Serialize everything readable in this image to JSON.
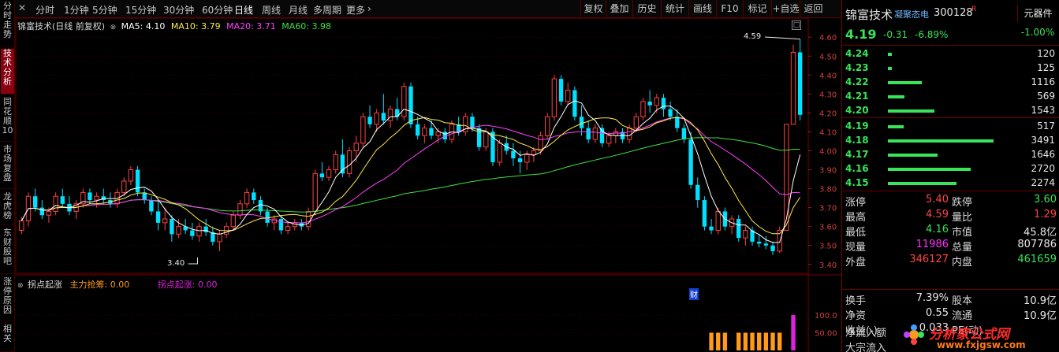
{
  "colors": {
    "up": "#ff4040",
    "down": "#00e0ff",
    "ma5": "#ffffff",
    "ma10": "#ffe84a",
    "ma20": "#ff40ff",
    "ma60": "#40e040",
    "indicator_orange": "#ff9a1a",
    "indicator_magenta": "#e020e0"
  },
  "left_tabs": [
    "分时走势",
    "技术分析",
    "同花顺10",
    "市场复盘",
    "龙虎榜",
    "东财股吧",
    "涨停原因",
    "相关"
  ],
  "toolbar": {
    "periods": [
      "分时",
      "1分钟",
      "5分钟",
      "15分钟",
      "30分钟",
      "60分钟",
      "日线",
      "周线",
      "月线",
      "多周期",
      "更多"
    ],
    "right_buttons": [
      "复权",
      "叠加",
      "历史",
      "统计",
      "画线",
      "F10",
      "标记",
      "+自选",
      "返回"
    ]
  },
  "chart_header": {
    "name": "锦富技术(日线 前复权)",
    "ma5": "MA5: 4.10",
    "ma10": "MA10: 3.79",
    "ma20": "MA20: 3.71",
    "ma60": "MA60: 3.98"
  },
  "chart_annotations": {
    "high_label": "4.59",
    "low_label": "3.40",
    "cai_mark": "财"
  },
  "indicator_header": {
    "name": "拐点起涨",
    "line1": "主力抢筹: 0.00",
    "line2": "拐点起涨: 0.00"
  },
  "chart_data": {
    "type": "candlestick",
    "y_axis_ticks": [
      "4.60",
      "4.50",
      "4.40",
      "4.30",
      "4.20",
      "4.10",
      "4.00",
      "3.90",
      "3.80",
      "3.70",
      "3.60",
      "3.50",
      "3.40"
    ],
    "indicator_ticks": [
      "100.0",
      "50.00"
    ],
    "ylim": [
      3.37,
      4.63
    ],
    "ohlc": [
      [
        3.58,
        3.65,
        3.56,
        3.63
      ],
      [
        3.63,
        3.78,
        3.6,
        3.76
      ],
      [
        3.76,
        3.8,
        3.68,
        3.7
      ],
      [
        3.7,
        3.74,
        3.64,
        3.66
      ],
      [
        3.66,
        3.7,
        3.62,
        3.68
      ],
      [
        3.68,
        3.78,
        3.66,
        3.76
      ],
      [
        3.76,
        3.8,
        3.7,
        3.72
      ],
      [
        3.72,
        3.76,
        3.66,
        3.68
      ],
      [
        3.68,
        3.74,
        3.64,
        3.72
      ],
      [
        3.72,
        3.8,
        3.7,
        3.78
      ],
      [
        3.78,
        3.8,
        3.72,
        3.74
      ],
      [
        3.74,
        3.78,
        3.7,
        3.76
      ],
      [
        3.76,
        3.8,
        3.72,
        3.74
      ],
      [
        3.74,
        3.78,
        3.7,
        3.72
      ],
      [
        3.72,
        3.8,
        3.7,
        3.78
      ],
      [
        3.78,
        3.86,
        3.76,
        3.84
      ],
      [
        3.84,
        3.92,
        3.82,
        3.9
      ],
      [
        3.9,
        3.92,
        3.76,
        3.78
      ],
      [
        3.78,
        3.8,
        3.72,
        3.74
      ],
      [
        3.74,
        3.76,
        3.66,
        3.68
      ],
      [
        3.68,
        3.74,
        3.58,
        3.62
      ],
      [
        3.62,
        3.7,
        3.58,
        3.64
      ],
      [
        3.64,
        3.66,
        3.52,
        3.56
      ],
      [
        3.56,
        3.64,
        3.54,
        3.6
      ],
      [
        3.6,
        3.64,
        3.56,
        3.58
      ],
      [
        3.58,
        3.62,
        3.53,
        3.55
      ],
      [
        3.55,
        3.62,
        3.52,
        3.6
      ],
      [
        3.6,
        3.64,
        3.55,
        3.57
      ],
      [
        3.57,
        3.6,
        3.5,
        3.52
      ],
      [
        3.52,
        3.58,
        3.47,
        3.56
      ],
      [
        3.56,
        3.62,
        3.54,
        3.6
      ],
      [
        3.6,
        3.68,
        3.58,
        3.66
      ],
      [
        3.66,
        3.74,
        3.64,
        3.72
      ],
      [
        3.72,
        3.8,
        3.7,
        3.78
      ],
      [
        3.78,
        3.8,
        3.72,
        3.74
      ],
      [
        3.74,
        3.76,
        3.66,
        3.68
      ],
      [
        3.68,
        3.7,
        3.6,
        3.62
      ],
      [
        3.62,
        3.66,
        3.58,
        3.64
      ],
      [
        3.64,
        3.66,
        3.56,
        3.58
      ],
      [
        3.58,
        3.62,
        3.56,
        3.6
      ],
      [
        3.6,
        3.64,
        3.58,
        3.62
      ],
      [
        3.62,
        3.64,
        3.58,
        3.6
      ],
      [
        3.6,
        3.7,
        3.58,
        3.68
      ],
      [
        3.68,
        3.9,
        3.66,
        3.88
      ],
      [
        3.88,
        3.94,
        3.84,
        3.86
      ],
      [
        3.86,
        3.92,
        3.84,
        3.9
      ],
      [
        3.9,
        4.0,
        3.88,
        3.98
      ],
      [
        3.98,
        4.06,
        3.86,
        3.88
      ],
      [
        3.88,
        4.02,
        3.86,
        4.0
      ],
      [
        4.0,
        4.08,
        3.94,
        4.04
      ],
      [
        4.04,
        4.2,
        4.02,
        4.18
      ],
      [
        4.18,
        4.24,
        4.12,
        4.14
      ],
      [
        4.14,
        4.22,
        4.1,
        4.2
      ],
      [
        4.2,
        4.3,
        4.14,
        4.16
      ],
      [
        4.16,
        4.24,
        4.12,
        4.22
      ],
      [
        4.22,
        4.28,
        4.16,
        4.18
      ],
      [
        4.18,
        4.36,
        4.16,
        4.34
      ],
      [
        4.34,
        4.36,
        4.12,
        4.14
      ],
      [
        4.14,
        4.18,
        4.06,
        4.08
      ],
      [
        4.08,
        4.14,
        4.04,
        4.12
      ],
      [
        4.12,
        4.16,
        4.06,
        4.08
      ],
      [
        4.08,
        4.12,
        4.04,
        4.1
      ],
      [
        4.1,
        4.12,
        4.04,
        4.06
      ],
      [
        4.06,
        4.16,
        4.04,
        4.14
      ],
      [
        4.14,
        4.18,
        4.08,
        4.1
      ],
      [
        4.1,
        4.2,
        4.08,
        4.18
      ],
      [
        4.18,
        4.2,
        4.1,
        4.12
      ],
      [
        4.12,
        4.14,
        4.0,
        4.02
      ],
      [
        4.02,
        4.12,
        4.0,
        4.1
      ],
      [
        4.1,
        4.12,
        3.92,
        3.94
      ],
      [
        3.94,
        4.06,
        3.92,
        4.04
      ],
      [
        4.04,
        4.08,
        3.98,
        4.0
      ],
      [
        4.0,
        4.04,
        3.92,
        3.96
      ],
      [
        3.96,
        4.0,
        3.88,
        3.94
      ],
      [
        3.94,
        4.0,
        3.9,
        3.98
      ],
      [
        3.98,
        4.02,
        3.94,
        4.0
      ],
      [
        4.0,
        4.1,
        3.98,
        4.08
      ],
      [
        4.08,
        4.2,
        4.06,
        4.18
      ],
      [
        4.18,
        4.4,
        4.16,
        4.38
      ],
      [
        4.38,
        4.4,
        4.24,
        4.26
      ],
      [
        4.26,
        4.36,
        4.24,
        4.32
      ],
      [
        4.32,
        4.34,
        4.16,
        4.18
      ],
      [
        4.18,
        4.24,
        4.08,
        4.12
      ],
      [
        4.12,
        4.16,
        4.04,
        4.06
      ],
      [
        4.06,
        4.14,
        4.04,
        4.12
      ],
      [
        4.12,
        4.14,
        4.02,
        4.04
      ],
      [
        4.04,
        4.1,
        4.02,
        4.08
      ],
      [
        4.08,
        4.12,
        4.04,
        4.1
      ],
      [
        4.1,
        4.12,
        4.04,
        4.06
      ],
      [
        4.06,
        4.14,
        4.04,
        4.12
      ],
      [
        4.12,
        4.2,
        4.1,
        4.18
      ],
      [
        4.18,
        4.28,
        4.16,
        4.26
      ],
      [
        4.26,
        4.32,
        4.2,
        4.24
      ],
      [
        4.24,
        4.3,
        4.2,
        4.28
      ],
      [
        4.28,
        4.3,
        4.18,
        4.22
      ],
      [
        4.22,
        4.26,
        4.16,
        4.18
      ],
      [
        4.18,
        4.22,
        4.1,
        4.12
      ],
      [
        4.12,
        4.14,
        4.04,
        4.06
      ],
      [
        4.06,
        4.1,
        3.8,
        3.82
      ],
      [
        3.82,
        3.86,
        3.7,
        3.74
      ],
      [
        3.74,
        3.76,
        3.58,
        3.6
      ],
      [
        3.6,
        3.64,
        3.56,
        3.58
      ],
      [
        3.58,
        3.7,
        3.56,
        3.68
      ],
      [
        3.68,
        3.7,
        3.58,
        3.6
      ],
      [
        3.6,
        3.66,
        3.56,
        3.64
      ],
      [
        3.64,
        3.66,
        3.52,
        3.54
      ],
      [
        3.54,
        3.6,
        3.5,
        3.58
      ],
      [
        3.58,
        3.6,
        3.5,
        3.52
      ],
      [
        3.52,
        3.56,
        3.49,
        3.51
      ],
      [
        3.51,
        3.55,
        3.48,
        3.5
      ],
      [
        3.5,
        3.52,
        3.45,
        3.47
      ],
      [
        3.47,
        3.6,
        3.46,
        3.58
      ],
      [
        3.58,
        4.14,
        3.58,
        4.14
      ],
      [
        4.14,
        4.56,
        4.14,
        4.52
      ],
      [
        4.52,
        4.59,
        4.16,
        4.19
      ]
    ],
    "indicator_bars": [
      0,
      0,
      0,
      0,
      0,
      0,
      0,
      0,
      0,
      0,
      0,
      0,
      0,
      0,
      0,
      0,
      0,
      0,
      0,
      0,
      0,
      0,
      0,
      0,
      0,
      0,
      0,
      0,
      0,
      0,
      0,
      0,
      0,
      0,
      0,
      0,
      0,
      0,
      0,
      0,
      0,
      0,
      0,
      0,
      0,
      0,
      0,
      0,
      0,
      0,
      0,
      0,
      0,
      0,
      0,
      0,
      0,
      0,
      0,
      0,
      0,
      0,
      0,
      0,
      0,
      0,
      0,
      0,
      0,
      0,
      0,
      0,
      0,
      0,
      0,
      0,
      0,
      0,
      0,
      0,
      0,
      0,
      0,
      0,
      0,
      0,
      0,
      0,
      0,
      0,
      0,
      0,
      0,
      0,
      0,
      0,
      0,
      0,
      0,
      0,
      0,
      0,
      50,
      50,
      50,
      0,
      50,
      50,
      50,
      50,
      50,
      50,
      50,
      0,
      100,
      0
    ],
    "indicator_bar_types": [
      "orange",
      "orange",
      "orange",
      "none",
      "orange",
      "orange",
      "orange",
      "orange",
      "orange",
      "orange",
      "orange",
      "none",
      "magenta",
      "none"
    ]
  },
  "quote": {
    "name": "锦富技术",
    "concept": "凝聚态电",
    "code": "300128",
    "code_mark": "R",
    "sector": "元器件",
    "price": "4.19",
    "change": "-0.31",
    "change_pct": "-6.89%",
    "sector_pct": "-1.00%"
  },
  "order_book": {
    "asks": [
      {
        "price": "4.24",
        "vol": "120",
        "bar": 0.035
      },
      {
        "price": "4.23",
        "vol": "125",
        "bar": 0.036
      },
      {
        "price": "4.22",
        "vol": "1116",
        "bar": 0.32
      },
      {
        "price": "4.21",
        "vol": "569",
        "bar": 0.16
      },
      {
        "price": "4.20",
        "vol": "1543",
        "bar": 0.44
      }
    ],
    "bids": [
      {
        "price": "4.19",
        "vol": "517",
        "bar": 0.15
      },
      {
        "price": "4.18",
        "vol": "3491",
        "bar": 1.0
      },
      {
        "price": "4.17",
        "vol": "1646",
        "bar": 0.47
      },
      {
        "price": "4.16",
        "vol": "2720",
        "bar": 0.78
      },
      {
        "price": "4.15",
        "vol": "2274",
        "bar": 0.65
      }
    ]
  },
  "stats": [
    {
      "l1": "涨停",
      "v1": "5.40",
      "c1": "red",
      "l2": "跌停",
      "v2": "3.60",
      "c2": "grn"
    },
    {
      "l1": "最高",
      "v1": "4.59",
      "c1": "red",
      "l2": "量比",
      "v2": "1.29",
      "c2": "red"
    },
    {
      "l1": "最低",
      "v1": "4.16",
      "c1": "grn",
      "l2": "市值",
      "v2": "45.8亿",
      "c2": "wht"
    },
    {
      "l1": "现量",
      "v1": "11986",
      "c1": "mag",
      "l2": "总量",
      "v2": "807786",
      "c2": "wht"
    },
    {
      "l1": "外盘",
      "v1": "346127",
      "c1": "red",
      "l2": "内盘",
      "v2": "461659",
      "c2": "grn"
    }
  ],
  "stats2": [
    {
      "l1": "换手",
      "v1": "7.39%",
      "l2": "股本",
      "v2": "10.9亿"
    },
    {
      "l1": "净资",
      "v1": "0.55",
      "l2": "流通",
      "v2": "10.9亿"
    },
    {
      "l1": "收益(-)",
      "v1": "0.033",
      "l2": "PE(动)",
      "v2": ""
    }
  ],
  "flows": [
    "净流入额",
    "大宗流入"
  ],
  "watermark": {
    "text": "分析家公式网",
    "url": "www.fxjgsw.com"
  }
}
